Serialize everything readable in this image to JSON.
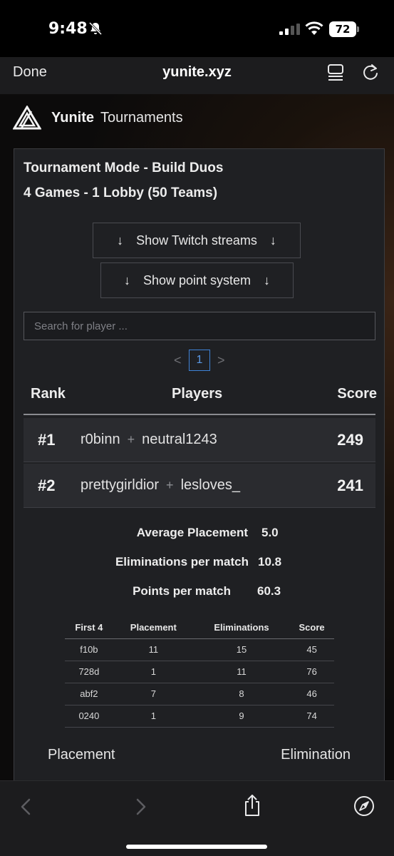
{
  "status_bar": {
    "time": "9:48",
    "battery": "72",
    "icons": [
      "bell-off-icon",
      "signal-icon",
      "wifi-icon",
      "battery-icon"
    ]
  },
  "browser": {
    "done_label": "Done",
    "url": "yunite.xyz",
    "icons": [
      "reader-icon",
      "reload-icon"
    ]
  },
  "site": {
    "brand_name": "Yunite",
    "brand_sub": "Tournaments"
  },
  "tournament": {
    "title_line1": "Tournament Mode - Build Duos",
    "title_line2": "4 Games - 1 Lobby (50 Teams)",
    "twitch_button": "Show Twitch streams",
    "points_button": "Show point system",
    "search_placeholder": "Search for player ...",
    "pagination": {
      "prev": "<",
      "current": "1",
      "next": ">"
    }
  },
  "leaderboard": {
    "headers": {
      "rank": "Rank",
      "players": "Players",
      "score": "Score"
    },
    "plus_sign": "+",
    "rows": [
      {
        "rank": "#1",
        "player1": "r0binn",
        "player2": "neutral1243",
        "score": "249"
      },
      {
        "rank": "#2",
        "player1": "prettygirldior",
        "player2": "lesloves_",
        "score": "241"
      }
    ]
  },
  "details": {
    "stats": [
      {
        "label": "Average Placement",
        "value": "5.0"
      },
      {
        "label": "Eliminations per match",
        "value": "10.8"
      },
      {
        "label": "Points per match",
        "value": "60.3"
      }
    ],
    "table_headers": [
      "First 4",
      "Placement",
      "Eliminations",
      "Score"
    ],
    "table_rows": [
      [
        "f10b",
        "11",
        "15",
        "45"
      ],
      [
        "728d",
        "1",
        "11",
        "76"
      ],
      [
        "abf2",
        "7",
        "8",
        "46"
      ],
      [
        "0240",
        "1",
        "9",
        "74"
      ]
    ],
    "footer_left": "Placement",
    "footer_right": "Elimination"
  },
  "colors": {
    "card_bg": "#1f2023",
    "row_bg": "#2a2b2f",
    "accent_blue": "#3f83d8"
  }
}
